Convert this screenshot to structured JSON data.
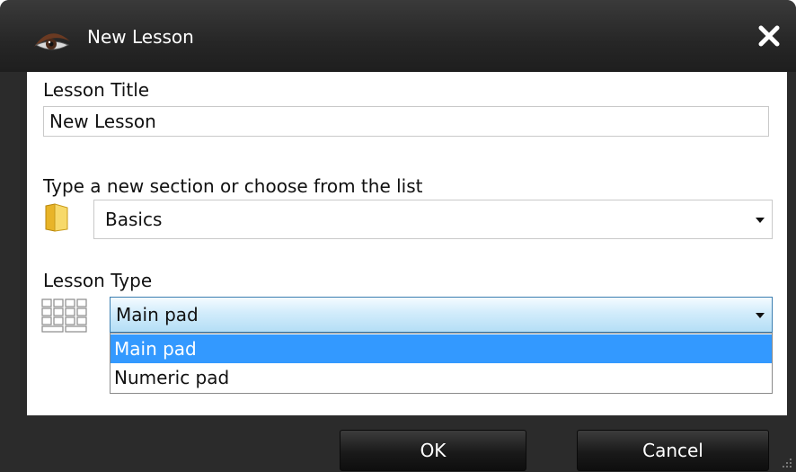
{
  "window": {
    "title": "New Lesson",
    "icon": "eye-logo-icon",
    "close_icon": "close-icon"
  },
  "lesson_title": {
    "label": "Lesson Title",
    "value": "New Lesson"
  },
  "section": {
    "label": "Type a new section or choose from the list",
    "icon": "folder-icon",
    "value": "Basics"
  },
  "lesson_type": {
    "label": "Lesson Type",
    "icon": "keyboard-icon",
    "value": "Main pad",
    "options": [
      {
        "label": "Main pad",
        "selected": true
      },
      {
        "label": "Numeric pad",
        "selected": false
      }
    ]
  },
  "buttons": {
    "ok": "OK",
    "cancel": "Cancel"
  },
  "colors": {
    "titlebar": "#262626",
    "selection": "#3399ff"
  }
}
